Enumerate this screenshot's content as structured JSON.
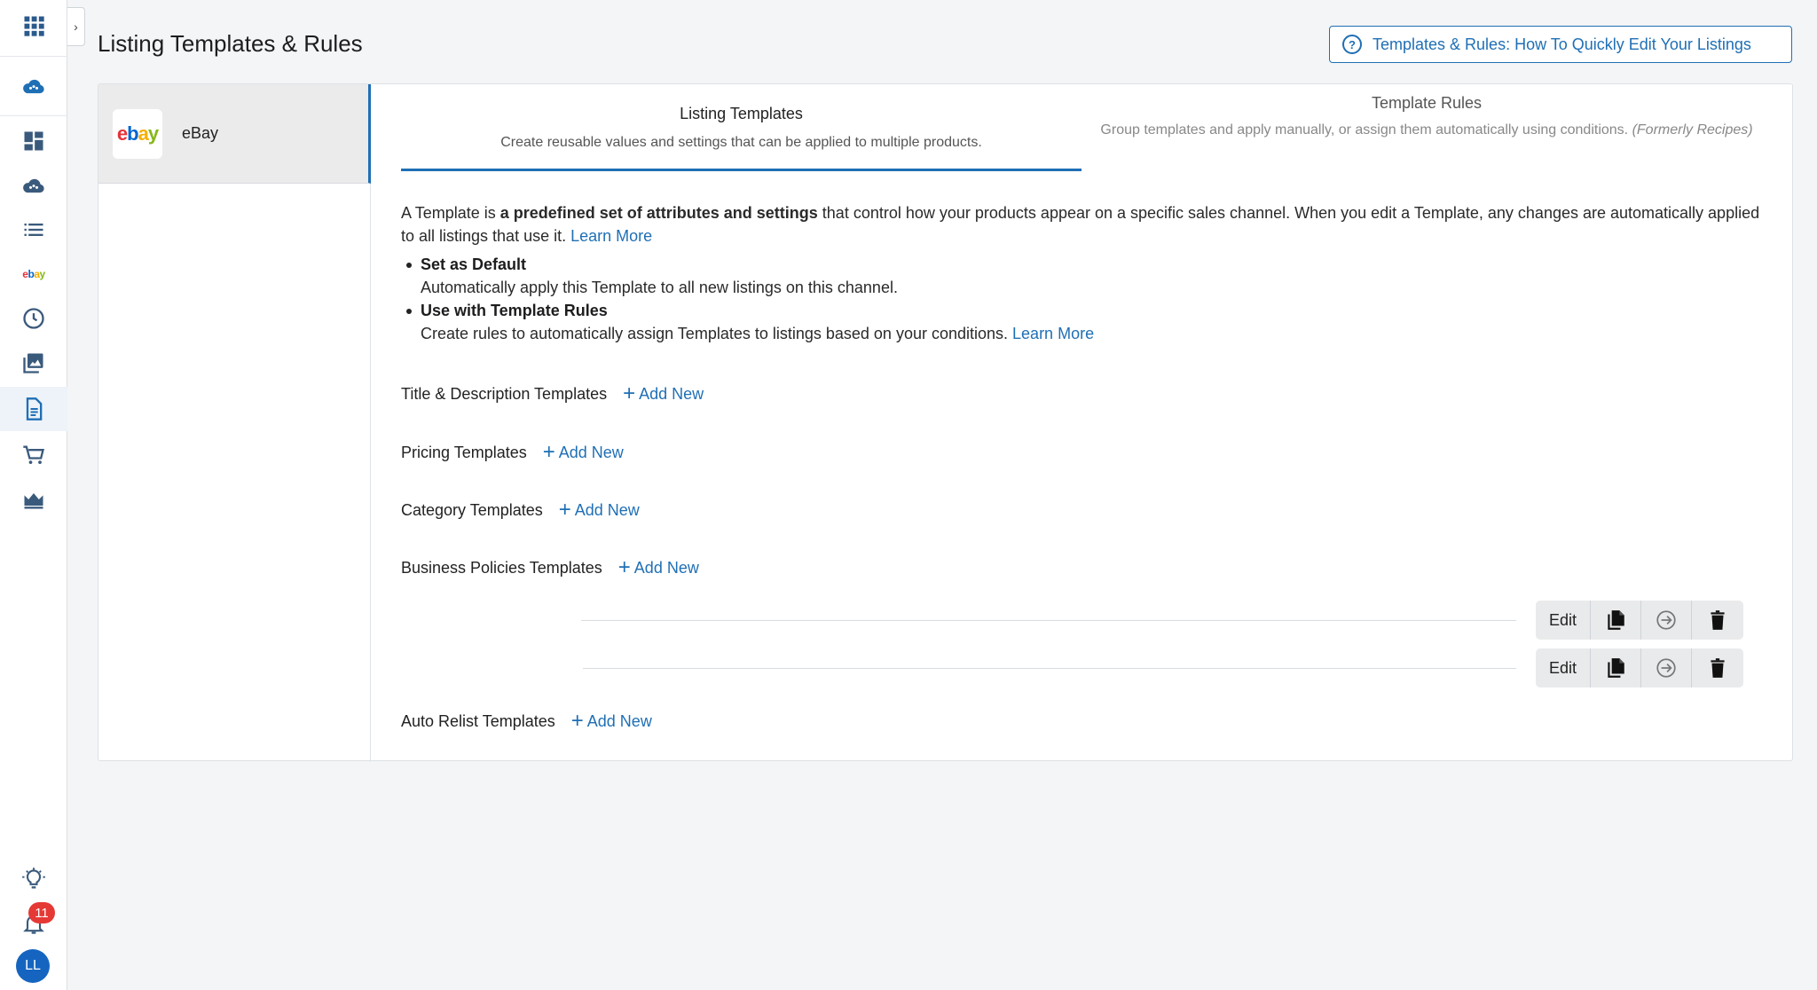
{
  "page": {
    "title": "Listing Templates & Rules",
    "help_button": "Templates & Rules: How To Quickly Edit Your Listings"
  },
  "rail": {
    "ebay_label": "ebay",
    "notification_count": "11",
    "avatar_initials": "LL"
  },
  "channel": {
    "name": "eBay",
    "logo_text": "ebay"
  },
  "tabs": [
    {
      "title": "Listing Templates",
      "description": "Create reusable values and settings that can be applied to multiple products."
    },
    {
      "title": "Template Rules",
      "description": "Group templates and apply manually, or assign them automatically using conditions.",
      "description_note": "(Formerly Recipes)"
    }
  ],
  "intro": {
    "text_1": "A Template is ",
    "bold": "a predefined set of attributes and settings",
    "text_2": " that control how your products appear on a specific sales channel. When you edit a Template, any changes are automatically applied to all listings that use it. ",
    "learn_more": "Learn More"
  },
  "bullets": [
    {
      "title": "Set as Default",
      "text": "Automatically apply this Template to all new listings on this channel."
    },
    {
      "title": "Use with Template Rules",
      "text": "Create rules to automatically assign Templates to listings based on your conditions. ",
      "learn_more": "Learn More"
    }
  ],
  "sections": [
    {
      "title": "Title & Description Templates",
      "add_label": "Add New"
    },
    {
      "title": "Pricing Templates",
      "add_label": "Add New"
    },
    {
      "title": "Category Templates",
      "add_label": "Add New"
    },
    {
      "title": "Business Policies Templates",
      "add_label": "Add New"
    },
    {
      "title": "Auto Relist Templates",
      "add_label": "Add New"
    }
  ],
  "row_actions": {
    "edit_label": "Edit"
  },
  "colors": {
    "accent": "#1f6fb5",
    "badge": "#e53935",
    "avatar": "#1565c0"
  }
}
